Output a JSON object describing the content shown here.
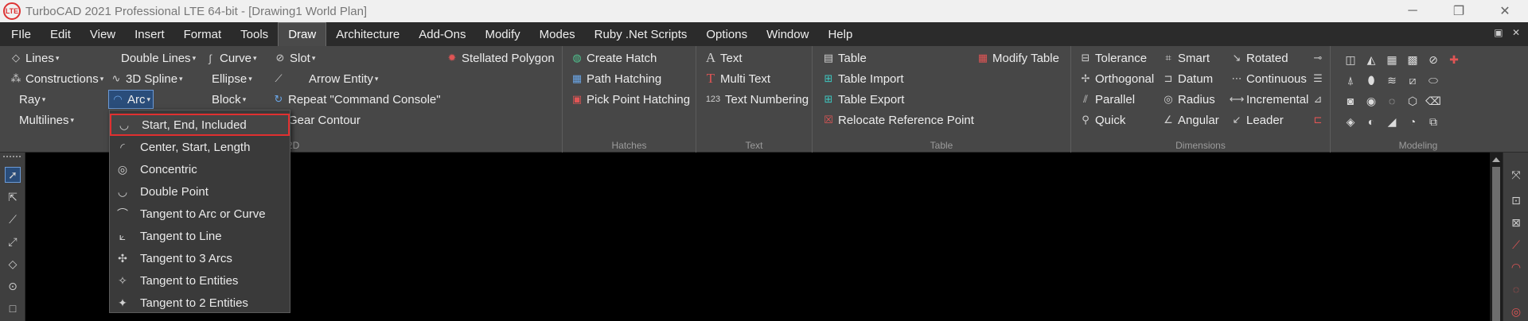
{
  "window": {
    "title": "TurboCAD 2021 Professional LTE 64-bit - [Drawing1 World Plan]",
    "logo_text": "LTE",
    "minimize": "─",
    "maximize": "❐",
    "close": "✕"
  },
  "menubar": {
    "items": [
      "FIle",
      "Edit",
      "View",
      "Insert",
      "Format",
      "Tools",
      "Draw",
      "Architecture",
      "Add-Ons",
      "Modify",
      "Modes",
      "Ruby .Net Scripts",
      "Options",
      "Window",
      "Help"
    ],
    "restore_controls": "▣ ✕"
  },
  "ribbon": {
    "draw2d": {
      "label": "Draw 2D",
      "lines": "Lines",
      "constructions": "Constructions",
      "ray": "Ray",
      "multilines": "Multilines",
      "double_lines": "Double Lines",
      "spline3d": "3D Spline",
      "arc": "Arc",
      "curve": "Curve",
      "ellipse": "Ellipse",
      "block": "Block",
      "slot": "Slot",
      "arrow_entity": "Arrow Entity",
      "repeat_console": "Repeat \"Command Console\"",
      "gear_contour": "Gear Contour",
      "stellated_polygon": "Stellated Polygon"
    },
    "hatches": {
      "label": "Hatches",
      "create_hatch": "Create Hatch",
      "path_hatching": "Path Hatching",
      "pick_point_hatching": "Pick Point Hatching"
    },
    "text": {
      "label": "Text",
      "text": "Text",
      "multi_text": "Multi Text",
      "text_numbering": "Text Numbering",
      "numbering_icon": "123"
    },
    "table": {
      "label": "Table",
      "table": "Table",
      "table_import": "Table Import",
      "table_export": "Table Export",
      "relocate_ref_point": "Relocate Reference Point",
      "modify_table": "Modify Table"
    },
    "dimensions": {
      "label": "Dimensions",
      "tolerance": "Tolerance",
      "orthogonal": "Orthogonal",
      "parallel": "Parallel",
      "quick": "Quick",
      "smart": "Smart",
      "datum": "Datum",
      "radius": "Radius",
      "angular": "Angular",
      "rotated": "Rotated",
      "continuous": "Continuous",
      "incremental": "Incremental",
      "leader": "Leader"
    },
    "modeling": {
      "label": "Modeling"
    }
  },
  "arc_menu": {
    "items": [
      "Start, End, Included",
      "Center, Start, Length",
      "Concentric",
      "Double Point",
      "Tangent to Arc or Curve",
      "Tangent to Line",
      "Tangent to 3 Arcs",
      "Tangent to Entities",
      "Tangent to 2 Entities"
    ],
    "highlighted_index": 0
  },
  "colors": {
    "accent_highlight": "#e03030",
    "selected_blue": "#2a4d7a",
    "ribbon_bg": "#474747",
    "canvas_bg": "#000000"
  }
}
